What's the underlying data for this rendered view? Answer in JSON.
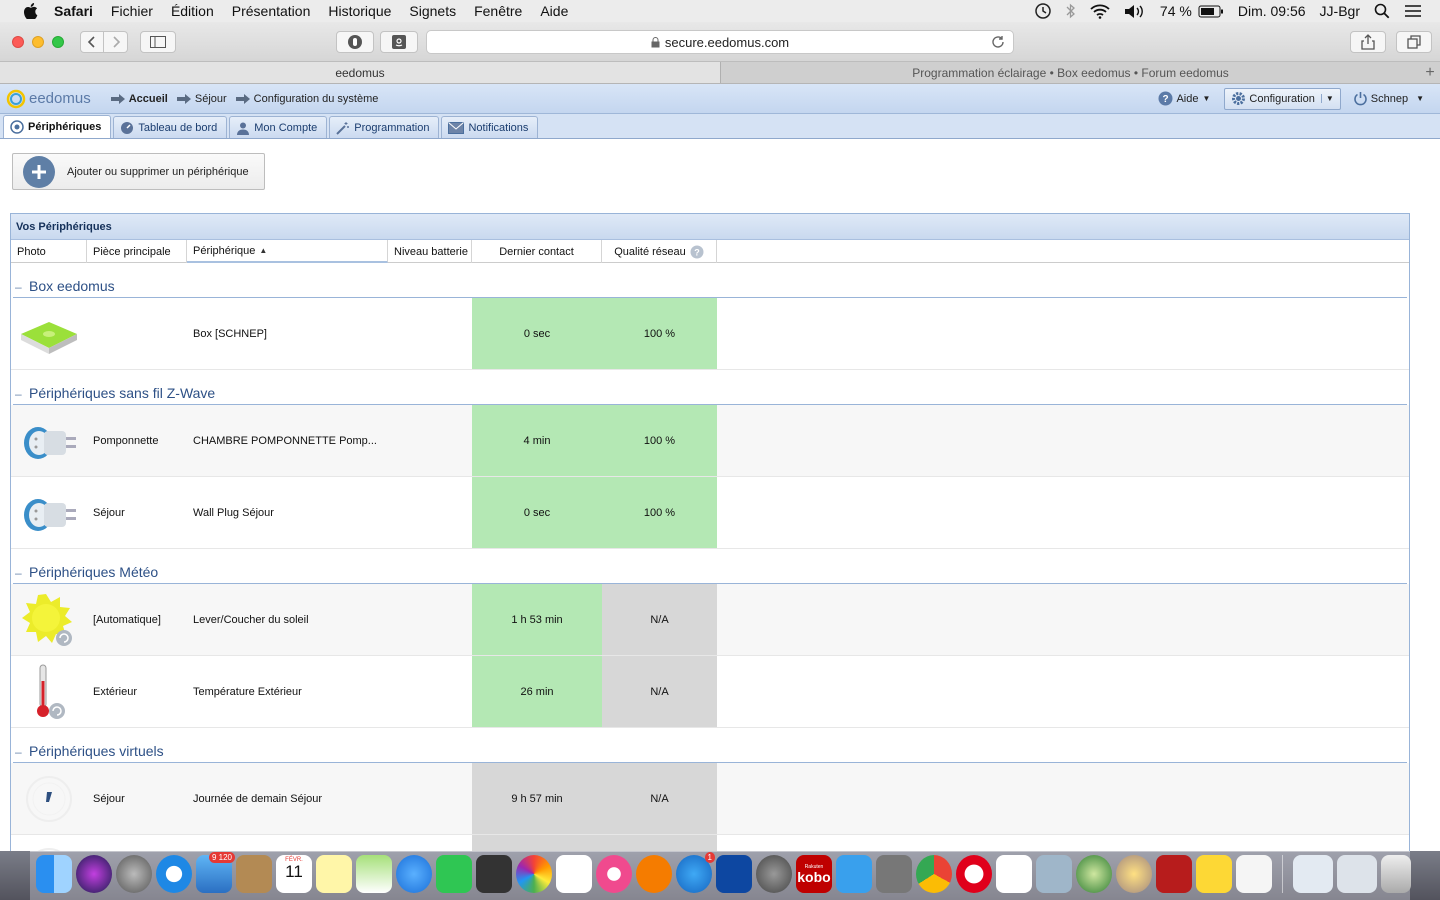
{
  "menubar": {
    "app": "Safari",
    "items": [
      "Fichier",
      "Édition",
      "Présentation",
      "Historique",
      "Signets",
      "Fenêtre",
      "Aide"
    ],
    "battery": "74 %",
    "clock": "Dim. 09:56",
    "user": "JJ-Bgr"
  },
  "safari": {
    "url": "secure.eedomus.com",
    "tabs": [
      {
        "label": "eedomus",
        "active": true
      },
      {
        "label": "Programmation éclairage • Box eedomus • Forum eedomus",
        "active": false
      }
    ],
    "new_tab_glyph": "+"
  },
  "header": {
    "logo_text": "eedomus",
    "breadcrumbs": [
      "Accueil",
      "Séjour",
      "Configuration du système"
    ],
    "aide": "Aide",
    "configuration": "Configuration",
    "user": "Schnep"
  },
  "tabs": [
    "Périphériques",
    "Tableau de bord",
    "Mon Compte",
    "Programmation",
    "Notifications"
  ],
  "add_button": "Ajouter ou supprimer un périphérique",
  "panel": {
    "title": "Vos Périphériques",
    "columns": [
      "Photo",
      "Pièce principale",
      "Périphérique",
      "Niveau batterie",
      "Dernier contact",
      "Qualité réseau"
    ],
    "groups": [
      {
        "title": "Box eedomus",
        "rows": [
          {
            "icon": "eedomus-box-icon",
            "room": "",
            "device": "Box [SCHNEP]",
            "battery": "",
            "contact": "0 sec",
            "quality": "100 %",
            "contact_status": "ok",
            "quality_status": "ok"
          }
        ]
      },
      {
        "title": "Périphériques sans fil Z-Wave",
        "rows": [
          {
            "icon": "wall-plug-icon",
            "room": "Pomponnette",
            "device": "CHAMBRE POMPONNETTE Pomp...",
            "battery": "",
            "contact": "4 min",
            "quality": "100 %",
            "contact_status": "ok",
            "quality_status": "ok"
          },
          {
            "icon": "wall-plug-icon",
            "room": "Séjour",
            "device": "Wall Plug Séjour",
            "battery": "",
            "contact": "0 sec",
            "quality": "100 %",
            "contact_status": "ok",
            "quality_status": "ok"
          }
        ]
      },
      {
        "title": "Périphériques Météo",
        "rows": [
          {
            "icon": "sun-icon",
            "room": "[Automatique]",
            "device": "Lever/Coucher du soleil",
            "battery": "",
            "contact": "1 h 53 min",
            "quality": "N/A",
            "contact_status": "ok",
            "quality_status": "na"
          },
          {
            "icon": "thermometer-icon",
            "room": "Extérieur",
            "device": "Température Extérieur",
            "battery": "",
            "contact": "26 min",
            "quality": "N/A",
            "contact_status": "ok",
            "quality_status": "na"
          }
        ]
      },
      {
        "title": "Périphériques virtuels",
        "rows": [
          {
            "icon": "virtual-device-icon",
            "room": "Séjour",
            "device": "Journée de demain Séjour",
            "battery": "",
            "contact": "9 h 57 min",
            "quality": "N/A",
            "contact_status": "na",
            "quality_status": "na"
          },
          {
            "icon": "virtual-device-icon",
            "room": "",
            "device": "",
            "battery": "",
            "contact": "",
            "quality": "",
            "contact_status": "na",
            "quality_status": "na"
          }
        ]
      }
    ]
  },
  "dock": {
    "badges": {
      "mail": "9 120",
      "appstore": "1"
    },
    "calendar_month": "FÉVR.",
    "calendar_day": "11",
    "kobo_brand": "Rakuten",
    "kobo_label": "kobo"
  },
  "colors": {
    "status_ok": "#b4e8b4",
    "status_na": "#d7d7d7",
    "group_title": "#2d5086"
  }
}
